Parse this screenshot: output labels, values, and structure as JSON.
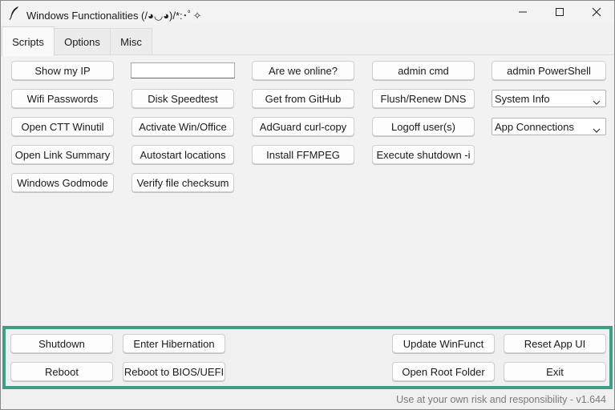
{
  "window": {
    "title": "Windows Functionalities (/◕◡◕)/*:･ﾟ✧"
  },
  "tabs": [
    {
      "label": "Scripts",
      "active": true
    },
    {
      "label": "Options",
      "active": false
    },
    {
      "label": "Misc",
      "active": false
    }
  ],
  "scripts": {
    "show_ip": "Show my IP",
    "ip_field_value": "",
    "are_we_online": "Are we online?",
    "admin_cmd": "admin cmd",
    "admin_powershell": "admin PowerShell",
    "wifi_passwords": "Wifi Passwords",
    "disk_speedtest": "Disk Speedtest",
    "get_from_github": "Get from GitHub",
    "flush_dns": "Flush/Renew DNS",
    "system_info_select": "System Info",
    "open_ctt_winutil": "Open CTT Winutil",
    "activate_win_office": "Activate Win/Office",
    "adguard_curl_copy": "AdGuard curl-copy",
    "logoff_users": "Logoff user(s)",
    "app_connections_select": "App Connections",
    "open_link_summary": "Open Link Summary",
    "autostart_locations": "Autostart locations",
    "install_ffmpeg": "Install FFMPEG",
    "execute_shutdown_i": "Execute shutdown -i",
    "windows_godmode": "Windows Godmode",
    "verify_checksum": "Verify file checksum"
  },
  "footer": {
    "shutdown": "Shutdown",
    "enter_hibernation": "Enter Hibernation",
    "update_winfunct": "Update WinFunct",
    "reset_app_ui": "Reset App UI",
    "reboot": "Reboot",
    "reboot_bios": "Reboot to BIOS/UEFI",
    "open_root_folder": "Open Root Folder",
    "exit": "Exit"
  },
  "status_text": "Use at your own risk and responsibility - v1.644",
  "colors": {
    "footer_border": "#3e9e84",
    "background": "#f0f0f0"
  },
  "icons": {
    "app": "feather-icon",
    "minimize": "minimize-icon",
    "maximize": "maximize-icon",
    "close": "close-icon",
    "dropdown": "chevron-down-icon"
  }
}
